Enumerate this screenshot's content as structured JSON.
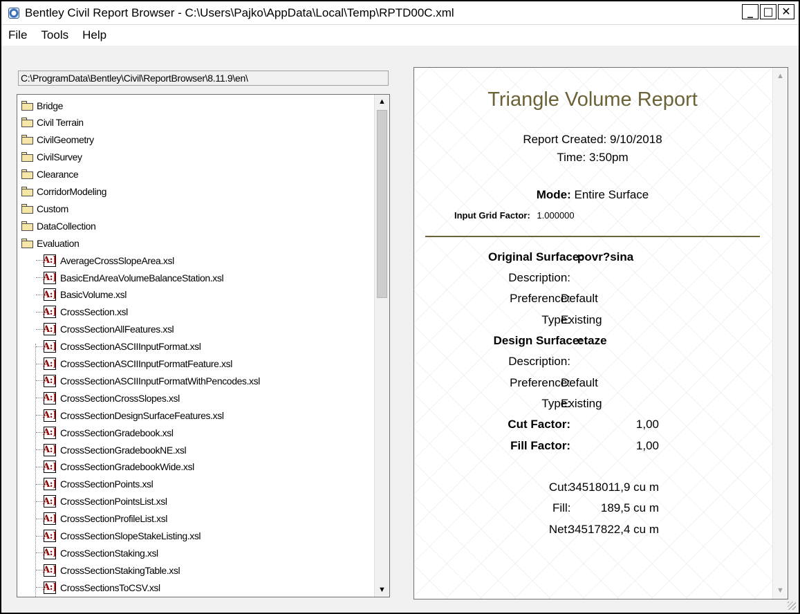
{
  "window": {
    "title": "Bentley Civil Report Browser - C:\\Users\\Pajko\\AppData\\Local\\Temp\\RPTD00C.xml",
    "minimize_glyph": "_",
    "maximize_glyph": "□",
    "close_glyph": "✕"
  },
  "menu": [
    "File",
    "Tools",
    "Help"
  ],
  "path": "C:\\ProgramData\\Bentley\\Civil\\ReportBrowser\\8.11.9\\en\\",
  "tree": {
    "folders": [
      "Bridge",
      "Civil Terrain",
      "CivilGeometry",
      "CivilSurvey",
      "Clearance",
      "CorridorModeling",
      "Custom",
      "DataCollection",
      "Evaluation"
    ],
    "xsl_icon_text": "A:]",
    "files": [
      "AverageCrossSlopeArea.xsl",
      "BasicEndAreaVolumeBalanceStation.xsl",
      "BasicVolume.xsl",
      "CrossSection.xsl",
      "CrossSectionAllFeatures.xsl",
      "CrossSectionASCIIInputFormat.xsl",
      "CrossSectionASCIIInputFormatFeature.xsl",
      "CrossSectionASCIIInputFormatWithPencodes.xsl",
      "CrossSectionCrossSlopes.xsl",
      "CrossSectionDesignSurfaceFeatures.xsl",
      "CrossSectionGradebook.xsl",
      "CrossSectionGradebookNE.xsl",
      "CrossSectionGradebookWide.xsl",
      "CrossSectionPoints.xsl",
      "CrossSectionPointsList.xsl",
      "CrossSectionProfileList.xsl",
      "CrossSectionSlopeStakeListing.xsl",
      "CrossSectionStaking.xsl",
      "CrossSectionStakingTable.xsl",
      "CrossSectionsToCSV.xsl"
    ]
  },
  "report": {
    "title": "Triangle Volume Report",
    "created_label": "Report Created:",
    "created_value": "9/10/2018",
    "time_label": "Time:",
    "time_value": "3:50pm",
    "mode_label": "Mode:",
    "mode_value": "Entire Surface",
    "grid_label": "Input Grid Factor:",
    "grid_value": "1.000000",
    "original_label": "Original Surface:",
    "original_value": "povr?sina",
    "design_label": "Design Surface:",
    "design_value": "etaze",
    "description_label": "Description:",
    "preference_label": "Preference:",
    "preference_value": "Default",
    "type_label": "Type:",
    "type_value": "Existing",
    "cut_factor_label": "Cut Factor:",
    "cut_factor_value": "1,00",
    "fill_factor_label": "Fill Factor:",
    "fill_factor_value": "1,00",
    "cut_label": "Cut:",
    "cut_value": "34518011,9 cu m",
    "fill_label": "Fill:",
    "fill_value": "189,5 cu m",
    "net_label": "Net:",
    "net_value": "34517822,4 cu m"
  },
  "icons": {
    "scroll_up": "▲",
    "scroll_down": "▼"
  }
}
